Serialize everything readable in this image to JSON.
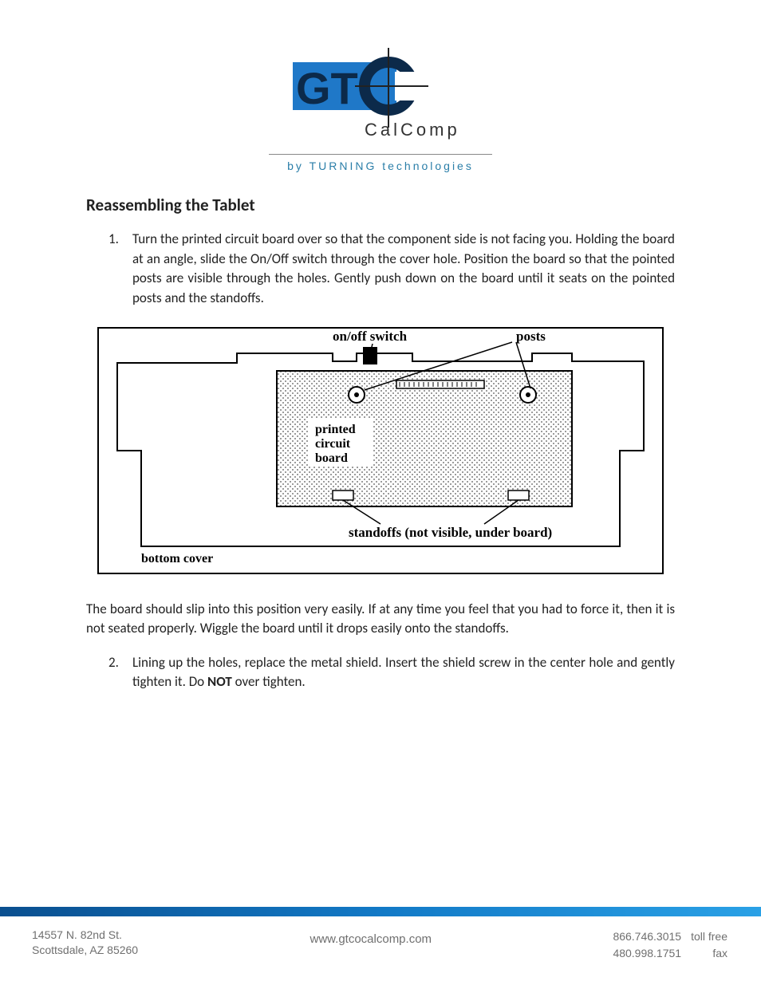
{
  "logo": {
    "main_text_gt": "GT",
    "main_text_co_c": "C",
    "calcomp": "C a l C o m p",
    "subline": "by  TURNING  technologies"
  },
  "section_title": "Reassembling the Tablet",
  "steps": {
    "s1_num": "1.",
    "s1": "Turn the printed circuit board over so that the component side is not facing you. Holding the board at an angle, slide the On/Off switch through the cover hole. Position the board so that the pointed posts are visible through the holes.  Gently push down on the board until it seats on the pointed posts and the standoffs.",
    "s2_num": "2.",
    "s2_a": "Lining up the holes, replace the metal shield.  Insert the shield screw in the center hole and gently tighten it.  Do ",
    "s2_bold": "NOT",
    "s2_b": " over tighten."
  },
  "body_para": "The board should slip into this position very easily.  If at any time you feel that you had to force it, then it is not seated properly.  Wiggle the board until it drops easily onto the standoffs.",
  "diagram": {
    "onoff": "on/off switch",
    "posts": "posts",
    "pcb_l1": "printed",
    "pcb_l2": "circuit",
    "pcb_l3": "board",
    "standoffs": "standoffs (not visible, under board)",
    "bottom": "bottom cover"
  },
  "footer": {
    "addr_l1": "14557 N. 82nd St.",
    "addr_l2": "Scottsdale, AZ 85260",
    "url": "www.gtcocalcomp.com",
    "phone1": "866.746.3015",
    "phone1_lbl": "toll free",
    "phone2": "480.998.1751",
    "phone2_lbl": "fax"
  }
}
